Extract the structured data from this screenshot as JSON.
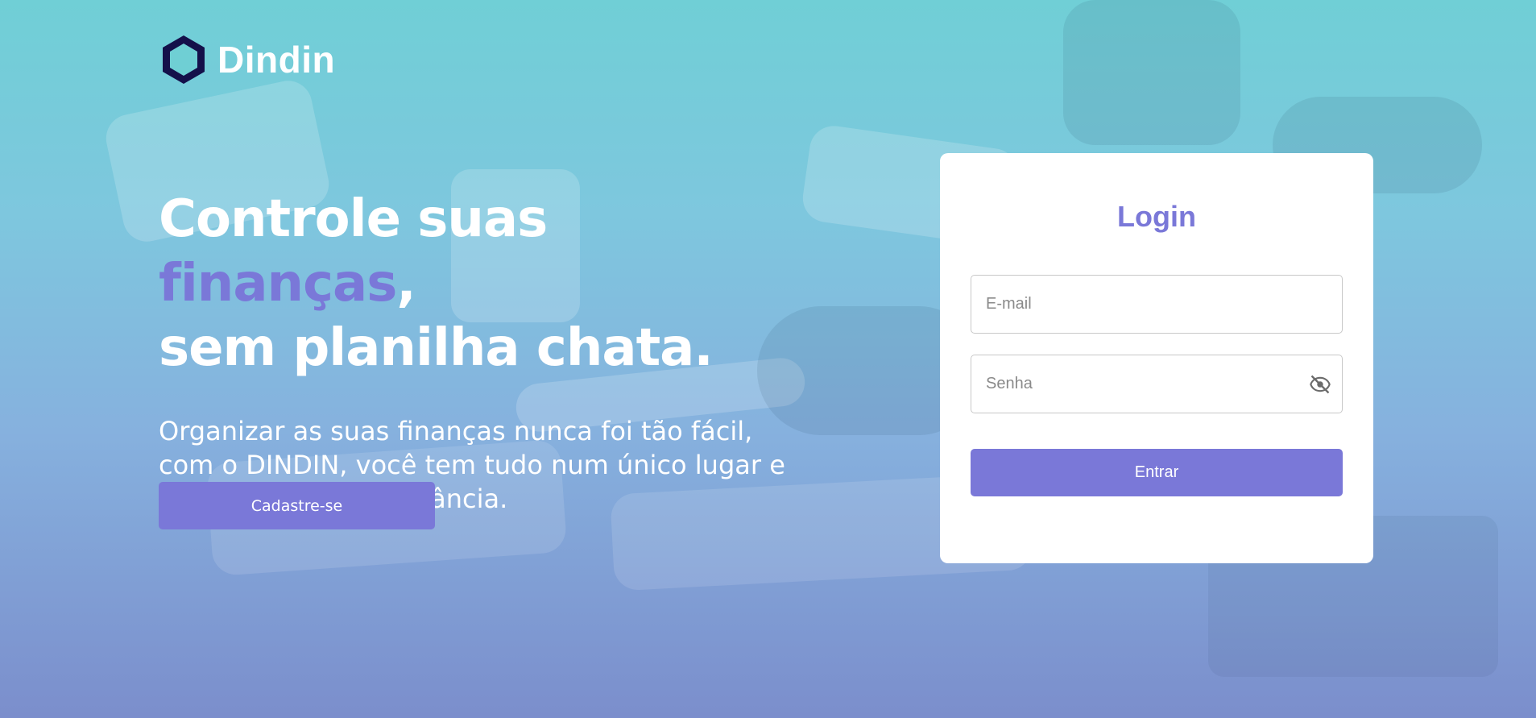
{
  "brand": {
    "name": "Dindin",
    "logo_icon": "hexagon-logo-icon",
    "logo_dark_color": "#14104a",
    "logo_fill_color": "#6fcfd4"
  },
  "colors": {
    "accent": "#7a78d8",
    "background_top": "#70cfd6",
    "background_bottom": "#7b8ecc",
    "card": "#ffffff"
  },
  "hero": {
    "title_part1": "Controle suas ",
    "title_accent": "finanças",
    "title_part2": ",",
    "title_line2": "sem planilha chata.",
    "subtitle": "Organizar as suas finanças nunca foi tão fácil, com o DINDIN, você tem tudo num único lugar e em um clique de distância.",
    "signup_label": "Cadastre-se"
  },
  "login": {
    "title": "Login",
    "email_placeholder": "E-mail",
    "password_placeholder": "Senha",
    "toggle_icon": "eye-off-icon",
    "submit_label": "Entrar"
  }
}
